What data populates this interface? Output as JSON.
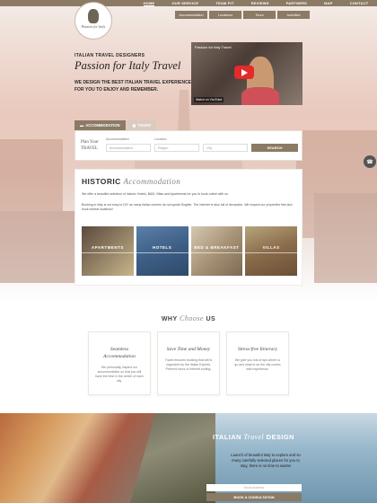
{
  "top_nav": {
    "items": [
      "HOME",
      "OUR SERVICE",
      "TEAM PIT",
      "REVIEWS",
      "PARTNERS",
      "MAP",
      "CONTACT"
    ]
  },
  "sub_nav": {
    "items": [
      "Accommodation",
      "Locations",
      "Tours",
      "Activities"
    ]
  },
  "logo": {
    "text": "Passion for Italy"
  },
  "hero": {
    "kicker": "ITALIAN TRAVEL DESIGNERS",
    "title": "Passion for Italy Travel",
    "desc": "WE DESIGN THE BEST ITALIAN TRAVEL EXPERIENCE FOR YOU TO ENJOY AND REMEMBER."
  },
  "video": {
    "title": "Passion for Italy Travel",
    "watch": "Watch on YouTube"
  },
  "search": {
    "tab_accommodation": "ACCOMMODATION",
    "tab_tours": "TOURS",
    "plan": "Plan Your",
    "travel": "TRAVEL",
    "label_accommodation": "Accommodation",
    "label_location": "Location",
    "select_accommodation": "Accommodation",
    "select_region": "Region",
    "select_city": "City",
    "search_button": "SEARCH"
  },
  "historic": {
    "title": "HISTORIC",
    "title_script": "Accommodation",
    "p1": "We offer a beautiful selection of historic Hotels, B&B, Villas and Apartments for you to book online with us.",
    "p2": "Booking in Italy is not easy to DIY as many Italian owners do not speak English. The internet is also full of deception. We inspect our properties first and book central locations!",
    "tiles": [
      "APARTMENTS",
      "HOTELS",
      "BED & BREAKFAST",
      "VILLAS"
    ]
  },
  "why": {
    "pre": "WHY",
    "script": "Choose",
    "post": "US"
  },
  "features": [
    {
      "title": "Seamless Accommodation",
      "desc": "We personally inspect our accommodation so that you will have the best in the center of each city."
    },
    {
      "title": "Save Time and Money",
      "desc": "Travel ensures booking that will is organized by the Italian Experts. Prevent hours of internet surfing."
    },
    {
      "title": "Stress-free Itinerary",
      "desc": "We give you lots of tips where to go and what to do the city comes with experience."
    }
  ],
  "bottom": {
    "title_pre": "ITALIAN",
    "title_script": "Travel",
    "title_post": "DESIGN",
    "desc": "Launch of beautiful Italy to explore and so many carefully selected places for you to stay, there is no time to waste!",
    "email_placeholder": "Email Address",
    "book_button": "BOOK A CONSULTATION"
  },
  "colors": {
    "accent": "#8b7a64",
    "hero_pink": "#e9c9bd"
  }
}
